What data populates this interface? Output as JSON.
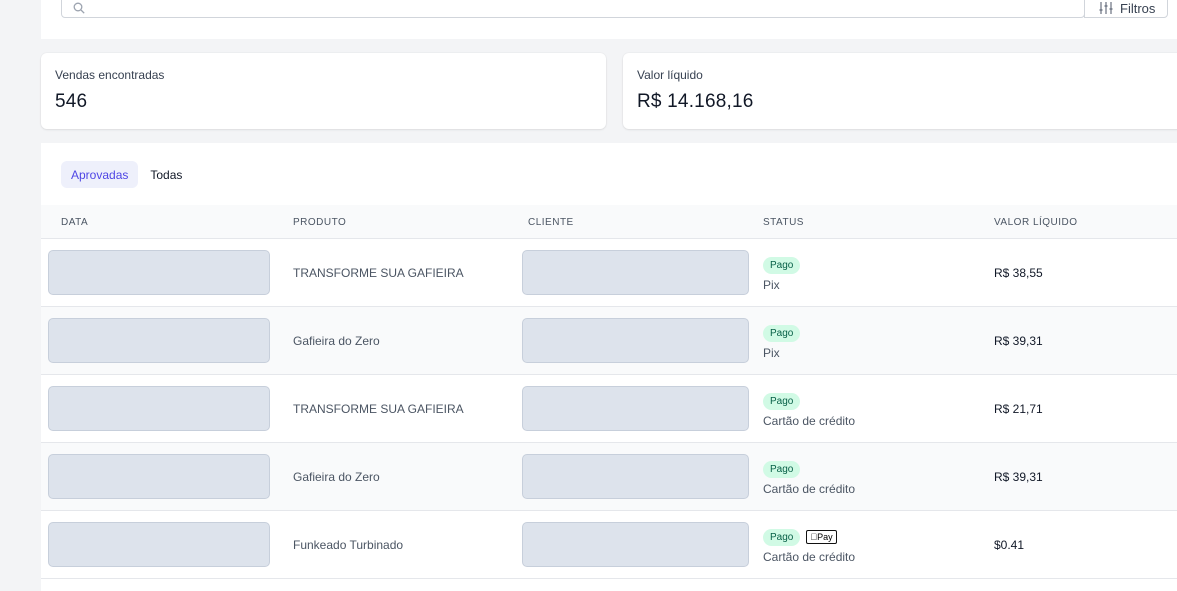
{
  "filters": {
    "label": "Filtros"
  },
  "stats": [
    {
      "label": "Vendas encontradas",
      "value": "546"
    },
    {
      "label": "Valor líquido",
      "value": "R$ 14.168,16"
    }
  ],
  "tabs": [
    {
      "label": "Aprovadas",
      "active": true
    },
    {
      "label": "Todas",
      "active": false
    }
  ],
  "table": {
    "headers": [
      "DATA",
      "PRODUTO",
      "CLIENTE",
      "STATUS",
      "VALOR LÍQUIDO"
    ],
    "rows": [
      {
        "product": "TRANSFORME SUA GAFIEIRA",
        "status": "Pago",
        "method": "Pix",
        "amount": "R$ 38,55",
        "wallet": ""
      },
      {
        "product": "Gafieira do Zero",
        "status": "Pago",
        "method": "Pix",
        "amount": "R$ 39,31",
        "wallet": ""
      },
      {
        "product": "TRANSFORME SUA GAFIEIRA",
        "status": "Pago",
        "method": "Cartão de crédito",
        "amount": "R$ 21,71",
        "wallet": ""
      },
      {
        "product": "Gafieira do Zero",
        "status": "Pago",
        "method": "Cartão de crédito",
        "amount": "R$ 39,31",
        "wallet": ""
      },
      {
        "product": "Funkeado Turbinado",
        "status": "Pago",
        "method": "Cartão de crédito",
        "amount": "$0.41",
        "wallet": "Pay"
      }
    ]
  },
  "colors": {
    "accent": "#4f46e5",
    "accent_bg": "#eef0fb",
    "status_paid_bg": "#d1fae5",
    "status_paid_text": "#065f46",
    "placeholder": "#dde3ec"
  },
  "icons": {
    "search": "search-icon",
    "filter": "sliders-icon",
    "wallet": "apple-pay-icon"
  }
}
